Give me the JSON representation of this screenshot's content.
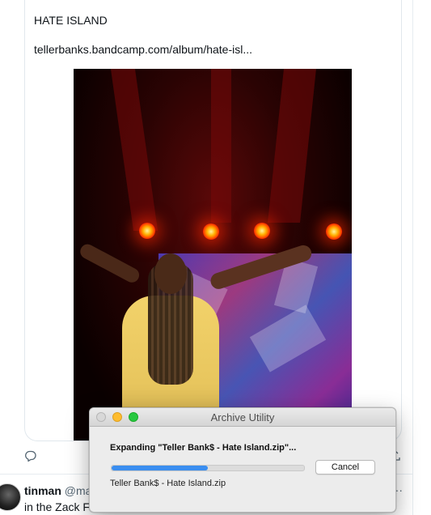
{
  "tweet": {
    "line1": "HATE ISLAND",
    "line2": "tellerbanks.bandcamp.com/album/hate-isl..."
  },
  "reply_preview": {
    "name": "tinman",
    "handle": "@ma",
    "text": "in the Zack Fo",
    "more": "···"
  },
  "archive_utility": {
    "window_title": "Archive Utility",
    "status": "Expanding \"Teller Bank$ - Hate Island.zip\"...",
    "progress": 0.5,
    "cancel_label": "Cancel",
    "file_name": "Teller Bank$ - Hate Island.zip",
    "colors": {
      "accent": "#3a8ef0",
      "close": "#d8d8d8",
      "minimize": "#febc2e",
      "zoom": "#28c840"
    }
  },
  "icons": {
    "reply": "reply-icon",
    "share": "share-icon",
    "more": "more-icon"
  }
}
